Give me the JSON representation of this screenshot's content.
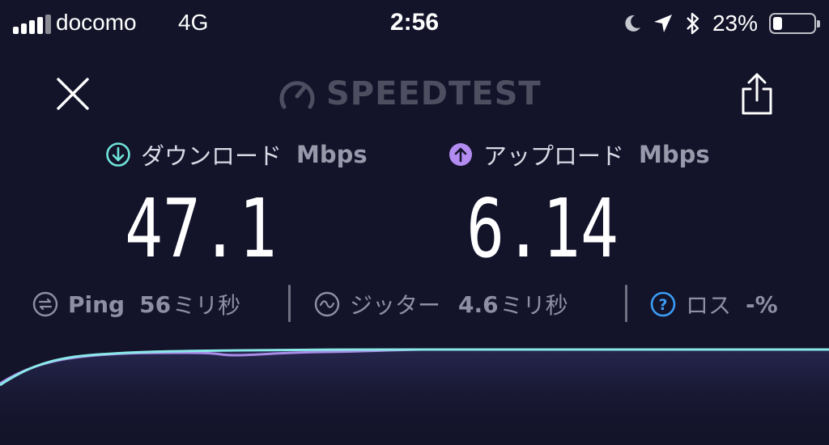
{
  "status_bar": {
    "carrier": "docomo",
    "network": "4G",
    "time": "2:56",
    "battery_percent_text": "23%",
    "battery_level": 0.23,
    "signal_bars_active": 4,
    "icons": [
      "moon-icon",
      "location-arrow-icon",
      "bluetooth-icon",
      "battery-icon"
    ]
  },
  "header": {
    "brand": "SPEEDTEST",
    "close_icon": "close-icon",
    "share_icon": "share-icon"
  },
  "download": {
    "label": "ダウンロード",
    "unit": "Mbps",
    "value": "47.1",
    "color": "#6fe3d9"
  },
  "upload": {
    "label": "アップロード",
    "unit": "Mbps",
    "value": "6.14",
    "color": "#b38cf2"
  },
  "stats": {
    "ping": {
      "label": "Ping",
      "value": "56",
      "unit": "ミリ秒"
    },
    "jitter": {
      "label": "ジッター",
      "value": "4.6",
      "unit": "ミリ秒"
    },
    "loss": {
      "label": "ロス",
      "value": "-%",
      "icon_color": "#3b9cf5"
    }
  },
  "colors": {
    "background": "#13132a",
    "brand_gray": "#4d4f61",
    "stat_gray": "#8e8fa2",
    "download_line": "#8ae8e8",
    "upload_line": "#a98ce8"
  }
}
